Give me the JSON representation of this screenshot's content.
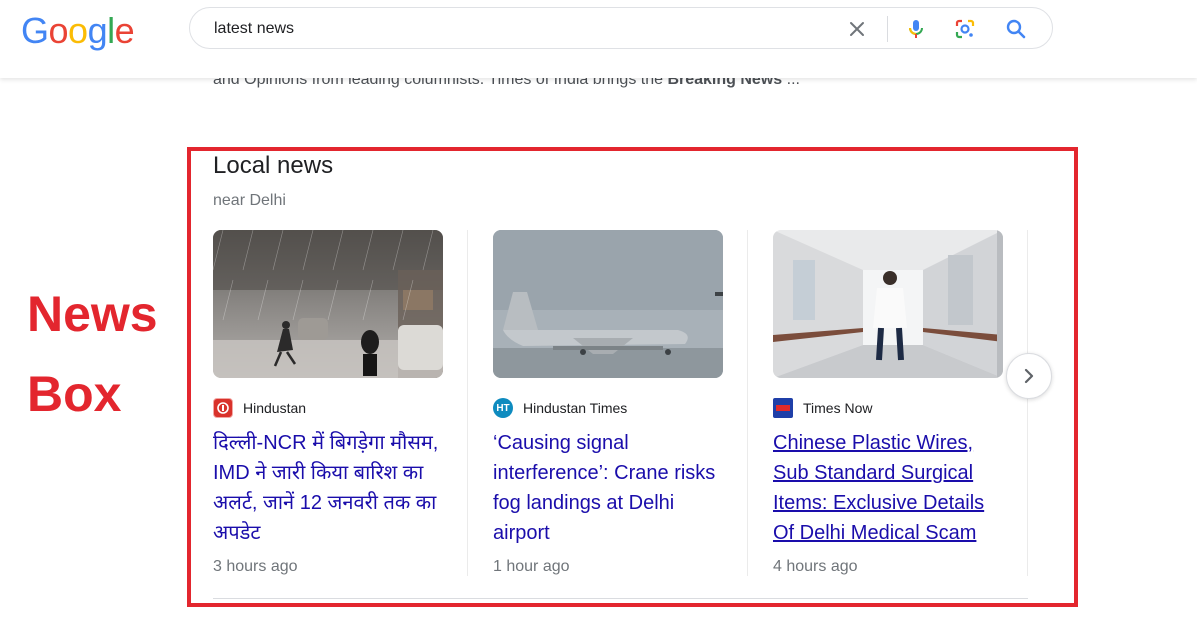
{
  "header": {
    "logo_letters": [
      "G",
      "o",
      "o",
      "g",
      "l",
      "e"
    ],
    "logo_colors": [
      "#4285F4",
      "#EA4335",
      "#FBBC05",
      "#4285F4",
      "#34A853",
      "#EA4335"
    ],
    "search_value": "latest news",
    "icons": [
      "close-icon",
      "mic-icon",
      "lens-icon",
      "search-icon"
    ]
  },
  "snippet": {
    "text": "and Opinions from leading columnists. Times of India brings the ",
    "bold": "Breaking News",
    "tail": " ..."
  },
  "annotation": {
    "line1": "News",
    "line2": "Box",
    "color": "#e3262e"
  },
  "local_news": {
    "title": "Local news",
    "subtitle": "near Delhi",
    "cards": [
      {
        "source": "Hindustan",
        "headline": "दिल्ली-NCR में बिगड़ेगा मौसम, IMD ने जारी किया बारिश का अलर्ट, जानें 12 जनवरी तक का अपडेट",
        "time": "3 hours ago"
      },
      {
        "source": "Hindustan Times",
        "headline": "‘Causing signal interference’: Crane risks fog landings at Delhi airport",
        "time": "1 hour ago"
      },
      {
        "source": "Times Now",
        "headline": "Chinese Plastic Wires, Sub Standard Surgical Items: Exclusive Details Of Delhi Medical Scam",
        "time": "4 hours ago"
      }
    ],
    "link_color": "#1a0dab"
  }
}
